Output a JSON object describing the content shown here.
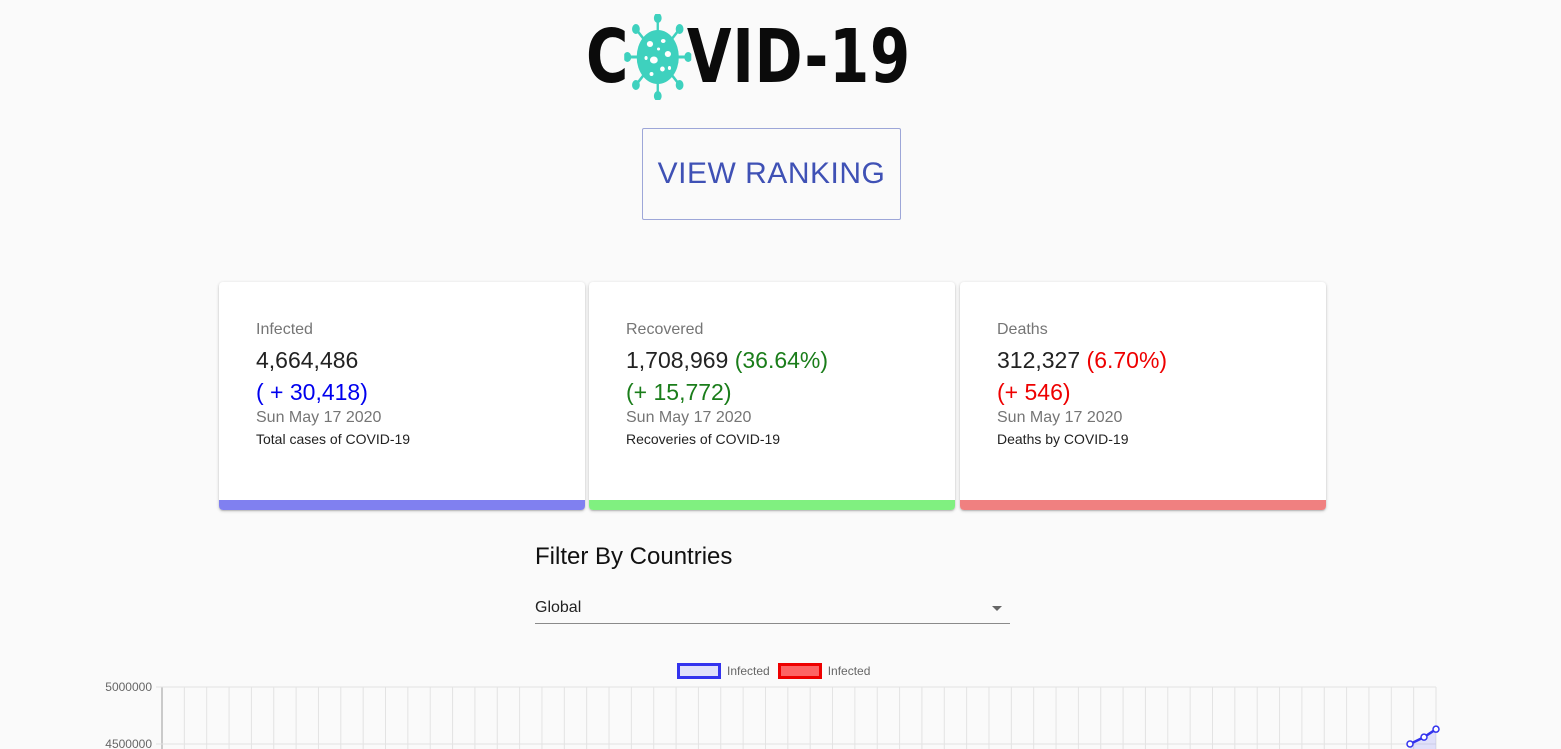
{
  "logo": {
    "text_before": "C",
    "text_after": "VID-19",
    "icon": "virus-icon",
    "virus_color": "#3ed1be"
  },
  "ranking_button": {
    "label": "VIEW RANKING"
  },
  "cards": {
    "infected": {
      "label": "Infected",
      "total": "4,664,486",
      "delta": "( + 30,418)",
      "date": "Sun May 17 2020",
      "description": "Total cases of COVID-19",
      "bar_color": "#8080f0"
    },
    "recovered": {
      "label": "Recovered",
      "total": "1,708,969",
      "percent": "(36.64%)",
      "delta": "(+ 15,772)",
      "date": "Sun May 17 2020",
      "description": "Recoveries of COVID-19",
      "bar_color": "#80f080"
    },
    "deaths": {
      "label": "Deaths",
      "total": "312,327",
      "percent": "(6.70%)",
      "delta": "(+ 546)",
      "date": "Sun May 17 2020",
      "description": "Deaths by COVID-19",
      "bar_color": "#f08080"
    }
  },
  "filter": {
    "title": "Filter By Countries",
    "selected": "Global"
  },
  "chart_data": {
    "type": "line",
    "series": [
      {
        "name": "Infected",
        "color": "#3333ee",
        "fill": "rgba(0,0,255,0.1)",
        "values": [
          4500000,
          4560000,
          4630000
        ]
      },
      {
        "name": "Infected",
        "color": "#ee0000",
        "fill": "rgba(255,0,0,0.6)",
        "values": []
      }
    ],
    "y_ticks": [
      "5000000",
      "4500000"
    ],
    "ylim": [
      4500000,
      5000000
    ],
    "grid": true,
    "legend": "top-center"
  }
}
